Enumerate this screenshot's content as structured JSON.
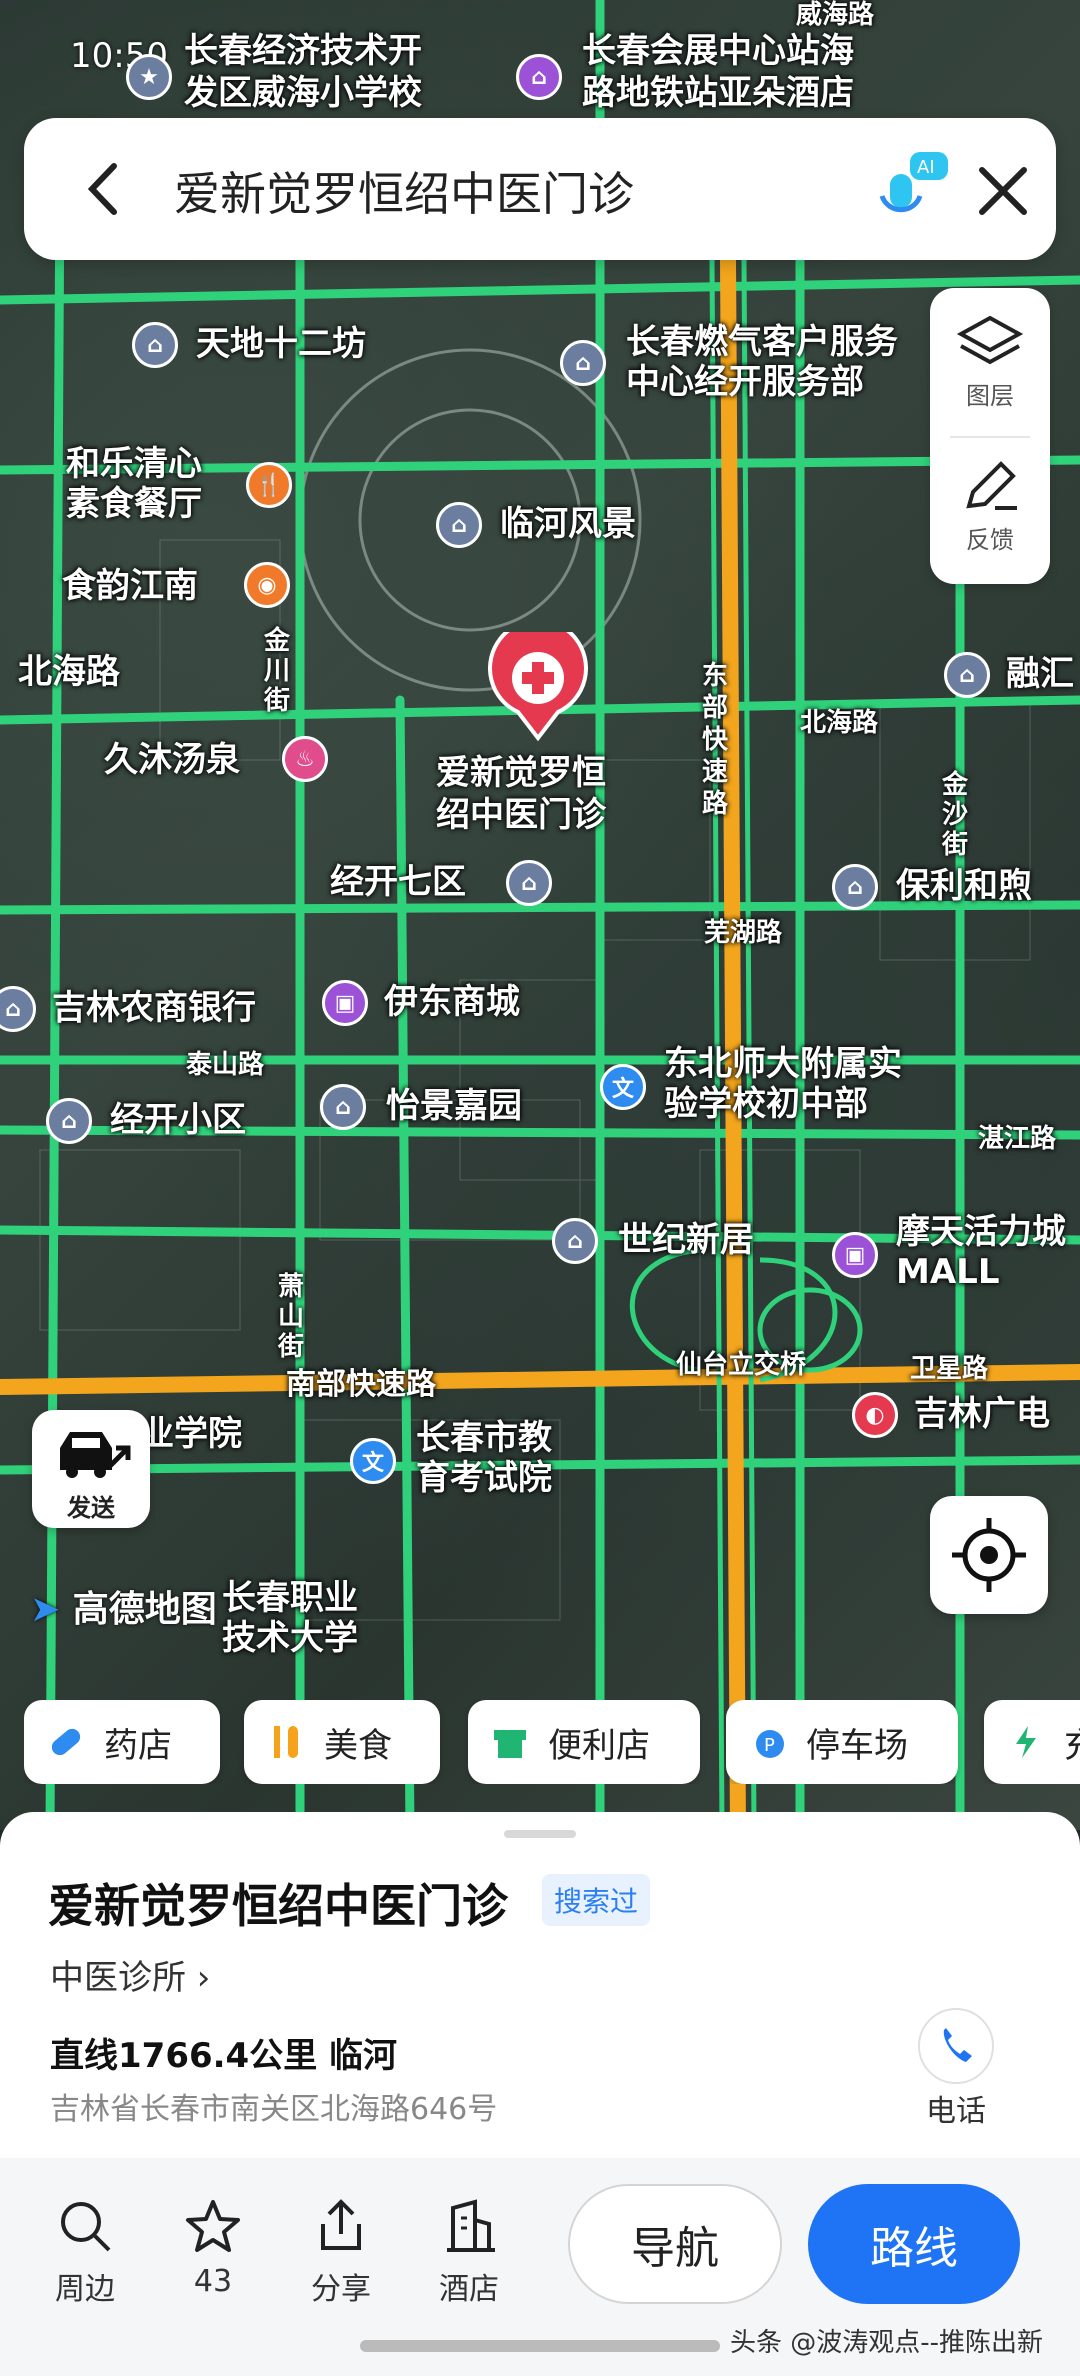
{
  "status": {
    "time": "10:50"
  },
  "search": {
    "query": "爱新觉罗恒绍中医门诊",
    "mic_badge": "AI"
  },
  "side_panel": {
    "layers_label": "图层",
    "feedback_label": "反馈"
  },
  "map": {
    "pois": [
      {
        "name": "长春经济技术开发区威海小学校",
        "line1": "长春经济技术开",
        "line2": "发区威海小学校"
      },
      {
        "name": "长春会展中心站海路地铁站亚朵酒店",
        "line1": "长春会展中心站海",
        "line2": "路地铁站亚朵酒店"
      },
      {
        "name": "天地十二坊"
      },
      {
        "name": "长春燃气客户服务中心经开服务部",
        "line1": "长春燃气客户服务",
        "line2": "中心经开服务部"
      },
      {
        "name": "和乐清心素食餐厅",
        "line1": "和乐清心",
        "line2": "素食餐厅"
      },
      {
        "name": "临河风景"
      },
      {
        "name": "食韵江南"
      },
      {
        "name": "北海路"
      },
      {
        "name": "融汇"
      },
      {
        "name": "久沐汤泉"
      },
      {
        "name": "爱新觉罗恒绍中医门诊",
        "line1": "爱新觉罗恒",
        "line2": "绍中医门诊"
      },
      {
        "name": "经开七区"
      },
      {
        "name": "保利和煦"
      },
      {
        "name": "吉林农商银行"
      },
      {
        "name": "伊东商城"
      },
      {
        "name": "东北师大附属实验学校初中部",
        "line1": "东北师大附属实",
        "line2": "验学校初中部"
      },
      {
        "name": "经开小区"
      },
      {
        "name": "怡景嘉园"
      },
      {
        "name": "世纪新居"
      },
      {
        "name": "摩天活力城MALL",
        "line1": "摩天活力城",
        "line2": "MALL"
      },
      {
        "name": "吉林广电"
      },
      {
        "name": "长春市教育考试院",
        "line1": "长春市教",
        "line2": "育考试院"
      },
      {
        "name": "长春职业技术大学",
        "line1": "长春职业",
        "line2": "技术大学"
      },
      {
        "name": "业学院"
      }
    ],
    "roads": [
      "威海路",
      "东部快速路",
      "北海路",
      "芜湖路",
      "泰山路",
      "湛江路",
      "南部快速路",
      "仙台立交桥",
      "卫星路",
      "金川街",
      "萧山街",
      "金沙街"
    ]
  },
  "send_button": {
    "label": "发送"
  },
  "logo": {
    "text": "高德地图"
  },
  "chips": [
    {
      "label": "药店",
      "icon": "pill-icon"
    },
    {
      "label": "美食",
      "icon": "food-icon"
    },
    {
      "label": "便利店",
      "icon": "store-icon"
    },
    {
      "label": "停车场",
      "icon": "parking-icon"
    },
    {
      "label": "充",
      "icon": "charging-icon"
    }
  ],
  "detail": {
    "name": "爱新觉罗恒绍中医门诊",
    "badge": "搜索过",
    "category": "中医诊所 ›",
    "distance": "直线1766.4公里  临河",
    "address": "吉林省长春市南关区北海路646号",
    "call_label": "电话"
  },
  "toolbar": {
    "nearby_label": "周边",
    "favorite_count": "43",
    "share_label": "分享",
    "hotel_label": "酒店",
    "navigate_label": "导航",
    "route_label": "路线"
  },
  "watermark": "头条 @波涛观点--推陈出新",
  "colors": {
    "road_green": "#2fd27a",
    "expressway": "#f2a51d",
    "accent": "#1e74f5",
    "poi_red": "#e53950"
  }
}
